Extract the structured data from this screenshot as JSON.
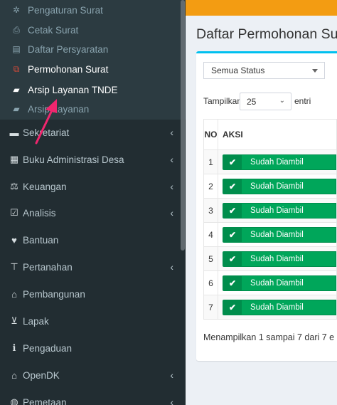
{
  "sidebar": {
    "submenu": [
      {
        "icon": "gear-icon",
        "glyph": "✲",
        "label": "Pengaturan Surat"
      },
      {
        "icon": "print-icon",
        "glyph": "⎙",
        "label": "Cetak Surat"
      },
      {
        "icon": "book-icon",
        "glyph": "▤",
        "label": "Daftar Persyaratan"
      },
      {
        "icon": "copy-icon",
        "glyph": "⧉",
        "label": "Permohonan Surat"
      },
      {
        "icon": "folder-open-icon",
        "glyph": "▰",
        "label": "Arsip Layanan TNDE"
      },
      {
        "icon": "folder-open-icon",
        "glyph": "▰",
        "label": "Arsip Layanan"
      }
    ],
    "menu": [
      {
        "icon": "box-icon",
        "glyph": "▬",
        "label": "Sekretariat",
        "chevron": "‹"
      },
      {
        "icon": "book-icon",
        "glyph": "▦",
        "label": "Buku Administrasi Desa",
        "chevron": "‹"
      },
      {
        "icon": "balance-scale-icon",
        "glyph": "⚖",
        "label": "Keuangan",
        "chevron": "‹"
      },
      {
        "icon": "check-square-icon",
        "glyph": "☑",
        "label": "Analisis",
        "chevron": "‹"
      },
      {
        "icon": "heart-icon",
        "glyph": "♥",
        "label": "Bantuan",
        "chevron": ""
      },
      {
        "icon": "map-signs-icon",
        "glyph": "⊤",
        "label": "Pertanahan",
        "chevron": "‹"
      },
      {
        "icon": "bank-icon",
        "glyph": "⌂",
        "label": "Pembangunan",
        "chevron": ""
      },
      {
        "icon": "cart-icon",
        "glyph": "⊻",
        "label": "Lapak",
        "chevron": ""
      },
      {
        "icon": "info-icon",
        "glyph": "ℹ",
        "label": "Pengaduan",
        "chevron": ""
      },
      {
        "icon": "bank-icon",
        "glyph": "⌂",
        "label": "OpenDK",
        "chevron": "‹"
      },
      {
        "icon": "globe-icon",
        "glyph": "◍",
        "label": "Pemetaan",
        "chevron": "‹"
      }
    ]
  },
  "main": {
    "title": "Daftar Permohonan Su",
    "status_filter": "Semua Status",
    "length_label": "Tampilkan",
    "length_value": "25",
    "entries_label": "entri",
    "columns": {
      "no": "NO",
      "aksi": "AKSI"
    },
    "rows": [
      {
        "no": "1",
        "status": "Sudah Diambil"
      },
      {
        "no": "2",
        "status": "Sudah Diambil"
      },
      {
        "no": "3",
        "status": "Sudah Diambil"
      },
      {
        "no": "4",
        "status": "Sudah Diambil"
      },
      {
        "no": "5",
        "status": "Sudah Diambil"
      },
      {
        "no": "6",
        "status": "Sudah Diambil"
      },
      {
        "no": "7",
        "status": "Sudah Diambil"
      }
    ],
    "info": "Menampilkan 1 sampai 7 dari 7 e"
  },
  "colors": {
    "sidebar_bg": "#222d32",
    "submenu_bg": "#2c3b41",
    "topbar": "#f39c12",
    "box_border": "#00c0ef",
    "status_green": "#00a65a",
    "pointer_arrow": "#f0266e",
    "active_icon_red": "#dd4b39"
  }
}
